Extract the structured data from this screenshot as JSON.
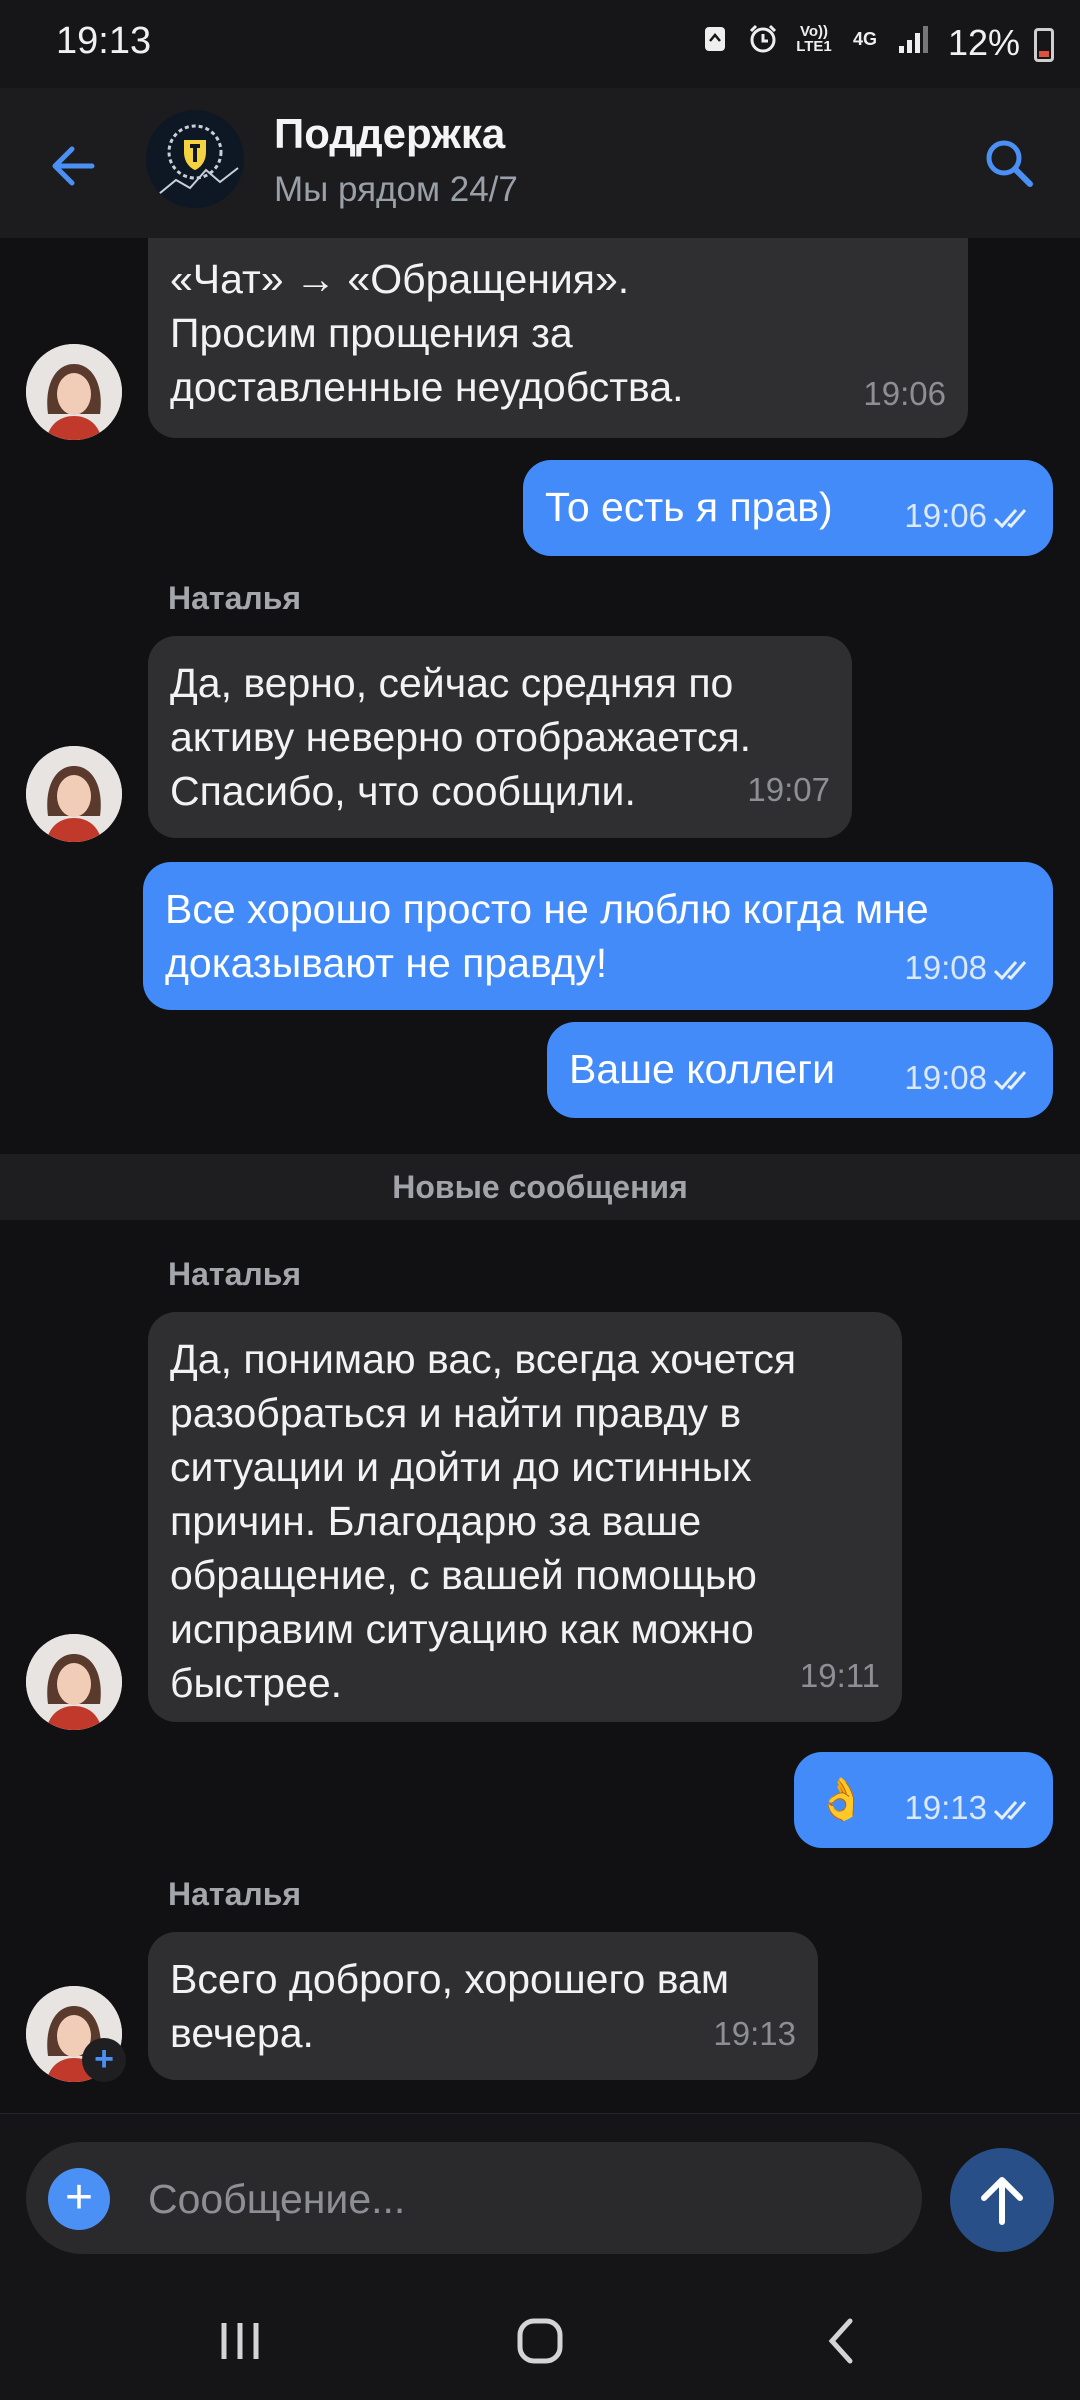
{
  "status_bar": {
    "time": "19:13",
    "network": "4G",
    "volte": "Vo)) LTE1",
    "battery": "12%",
    "icons": [
      "recycle-icon",
      "alarm-icon",
      "volte-icon",
      "network-4g-icon",
      "signal-icon",
      "battery-icon"
    ]
  },
  "header": {
    "title": "Поддержка",
    "subtitle": "Мы рядом 24/7",
    "back_icon": "arrow-left-icon",
    "search_icon": "search-icon"
  },
  "colors": {
    "background": "#111113",
    "incoming_bubble": "#2f2f32",
    "outgoing_bubble": "#428bf9",
    "accent": "#4a90f5",
    "send_button": "#284f87"
  },
  "messages": [
    {
      "direction": "in",
      "text": "«Чат» → «Обращения».\nПросим прощения за\nдоставленные неудобства.",
      "time": "19:06"
    },
    {
      "direction": "out",
      "text": "То есть я прав)",
      "time": "19:06",
      "status": "read"
    },
    {
      "direction": "in",
      "sender": "Наталья",
      "text": "Да, верно, сейчас средняя по\nактиву неверно отображается.\nСпасибо, что сообщили.",
      "time": "19:07"
    },
    {
      "direction": "out",
      "text": "Все хорошо просто не люблю когда мне\nдоказывают не правду!",
      "time": "19:08",
      "status": "read"
    },
    {
      "direction": "out",
      "text": "Ваше коллеги",
      "time": "19:08",
      "status": "read"
    },
    {
      "direction": "in",
      "sender": "Наталья",
      "text": "Да, понимаю вас, всегда хочется\nразобраться и найти правду в\nситуации и дойти до истинных\nпричин. Благодарю за ваше\nобращение, с вашей помощью\nисправим ситуацию как можно\nбыстрее.",
      "time": "19:11"
    },
    {
      "direction": "out",
      "text": "👌",
      "time": "19:13",
      "status": "read"
    },
    {
      "direction": "in",
      "sender": "Наталья",
      "text": "Всего доброго, хорошего вам\nвечера.",
      "time": "19:13"
    }
  ],
  "divider": {
    "label": "Новые сообщения"
  },
  "composer": {
    "placeholder": "Сообщение...",
    "attach_icon": "plus-icon",
    "send_icon": "arrow-up-icon"
  },
  "nav": {
    "recents_icon": "recents-icon",
    "home_icon": "home-icon",
    "back_icon": "back-chevron-icon"
  }
}
